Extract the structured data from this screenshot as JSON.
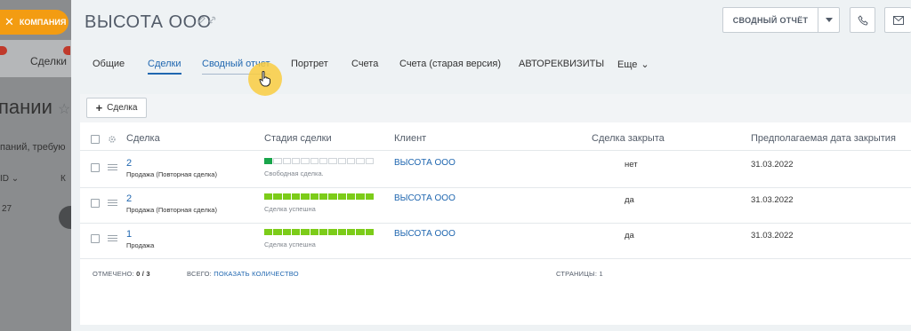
{
  "background": {
    "company_button": "КОМПАНИЯ",
    "deals_label": "Сделки",
    "title_fragment": "пании",
    "subtitle_fragment": "паний, требую",
    "id_header": "ID",
    "k_header": "К",
    "row_value": "27"
  },
  "header": {
    "title": "ВЫСОТА ООО",
    "report_button": "СВОДНЫЙ ОТЧЁТ"
  },
  "tabs": [
    {
      "label": "Общие"
    },
    {
      "label": "Сделки"
    },
    {
      "label": "Сводный отчет"
    },
    {
      "label": "Портрет"
    },
    {
      "label": "Счета"
    },
    {
      "label": "Счета (старая версия)"
    },
    {
      "label": "АВТОРЕКВИЗИТЫ"
    },
    {
      "label": "Еще"
    }
  ],
  "toolbar": {
    "add_deal": "Сделка"
  },
  "table": {
    "columns": [
      "Сделка",
      "Стадия сделки",
      "Клиент",
      "Сделка закрыта",
      "Предполагаемая дата закрытия"
    ],
    "rows": [
      {
        "num": "2",
        "type": "Продажа (Повторная сделка)",
        "stage": "Свободная сделка.",
        "stage_progress": 0.1,
        "client": "ВЫСОТА ООО",
        "closed": "нет",
        "date": "31.03.2022"
      },
      {
        "num": "2",
        "type": "Продажа (Повторная сделка)",
        "stage": "Сделка успешна",
        "stage_progress": 1.0,
        "client": "ВЫСОТА ООО",
        "closed": "да",
        "date": "31.03.2022"
      },
      {
        "num": "1",
        "type": "Продажа",
        "stage": "Сделка успешна",
        "stage_progress": 1.0,
        "client": "ВЫСОТА ООО",
        "closed": "да",
        "date": "31.03.2022"
      }
    ]
  },
  "footer": {
    "marked_label": "ОТМЕЧЕНО:",
    "marked_value": "0 / 3",
    "total_label": "ВСЕГО:",
    "total_link": "ПОКАЗАТЬ КОЛИЧЕСТВО",
    "pages_label": "СТРАНИЦЫ:",
    "pages_value": "1"
  }
}
